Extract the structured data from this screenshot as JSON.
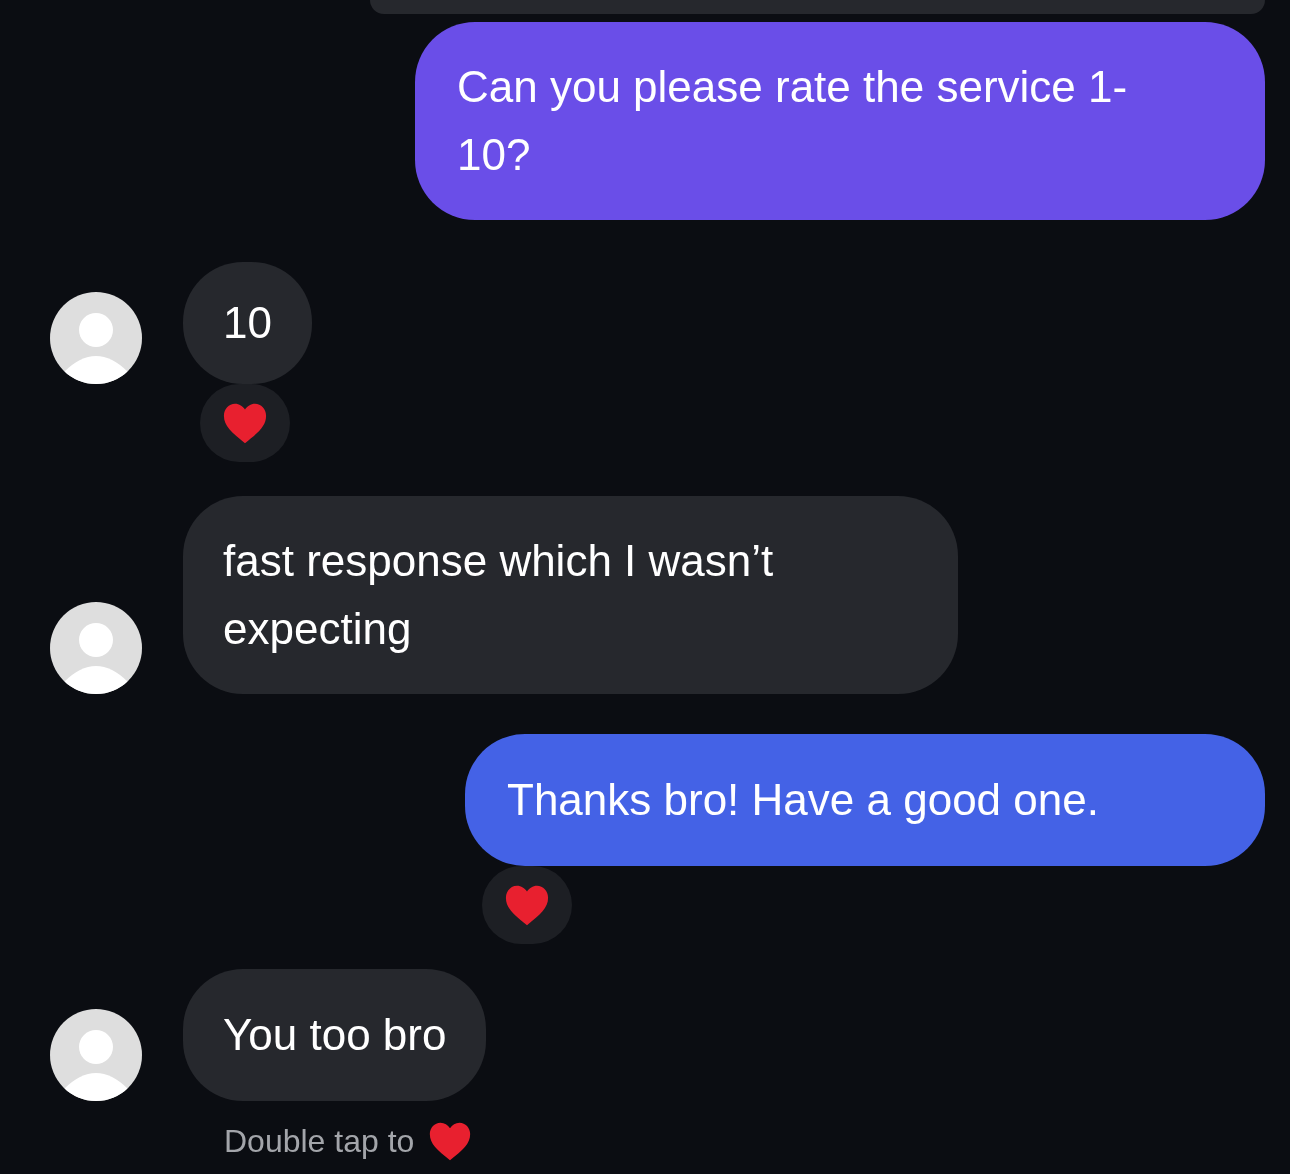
{
  "messages": [
    {
      "kind": "outgoing",
      "text": "Can you please rate the service 1-10?",
      "color": "#6a4ee8",
      "reaction": false
    },
    {
      "kind": "incoming",
      "text": "10",
      "reaction": true
    },
    {
      "kind": "incoming",
      "text": "fast response which I wasn’t expecting",
      "reaction": false
    },
    {
      "kind": "outgoing",
      "text": "Thanks bro! Have a good one.",
      "color": "#4462e6",
      "reaction": true
    },
    {
      "kind": "incoming",
      "text": "You too bro",
      "reaction": false
    }
  ],
  "hint": {
    "text": "Double tap to"
  }
}
